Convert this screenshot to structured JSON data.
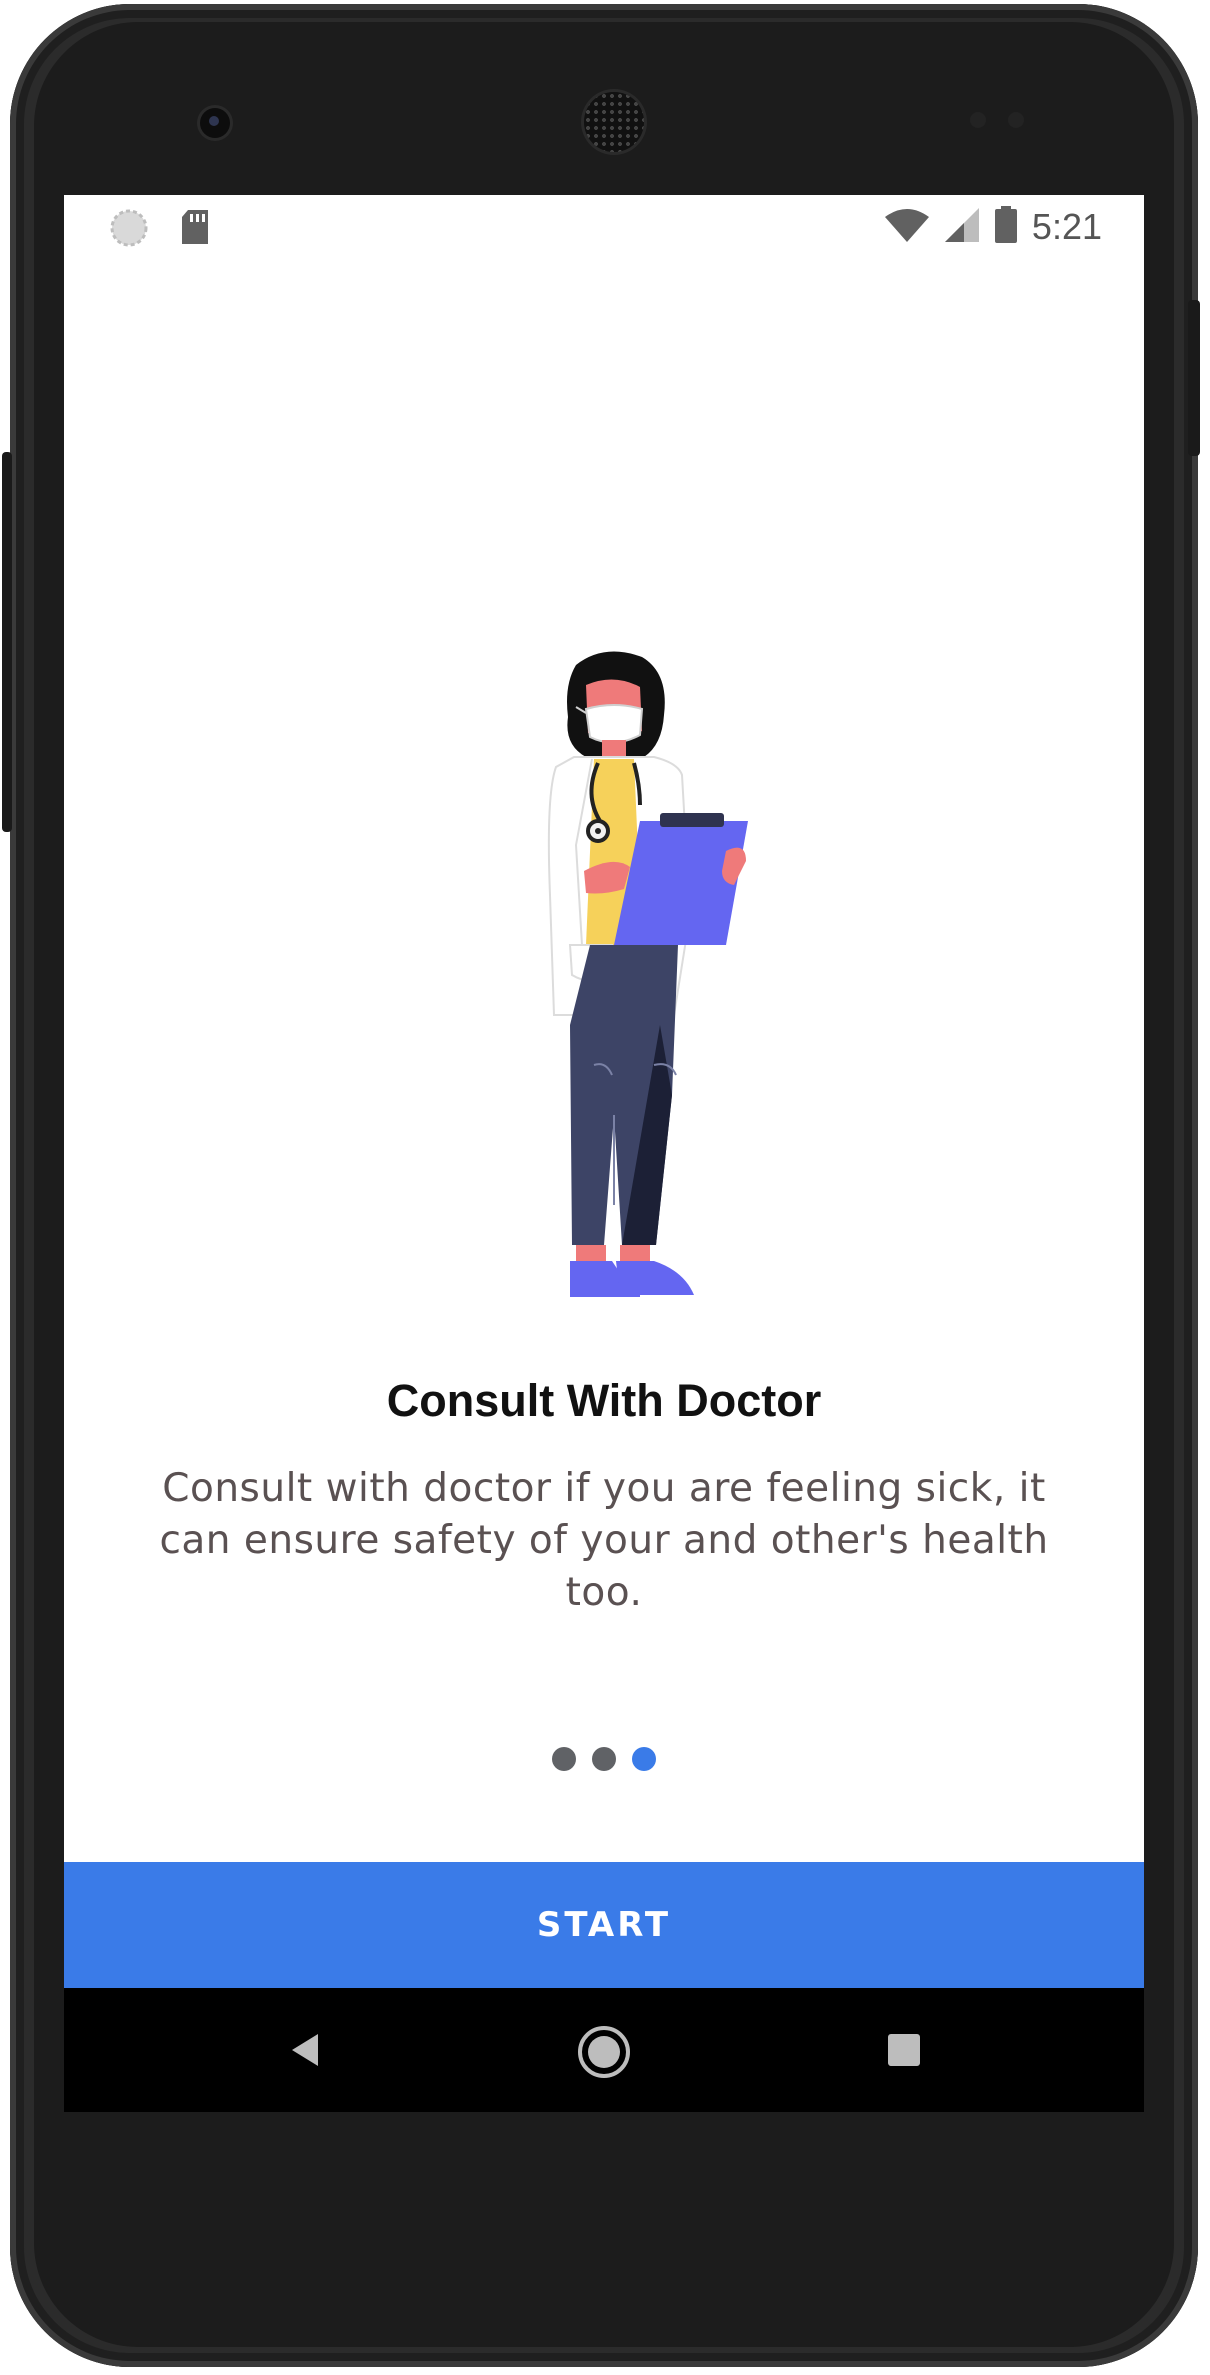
{
  "status_bar": {
    "time": "5:21",
    "icons": [
      "sync-icon",
      "sd-card-icon",
      "wifi-icon",
      "signal-icon",
      "battery-icon"
    ]
  },
  "onboarding": {
    "title": "Consult With Doctor",
    "description": "Consult with doctor if you are feeling sick, it can ensure safety of your and other's health too.",
    "page_count": 3,
    "active_page": 3
  },
  "actions": {
    "start_label": "START"
  },
  "nav_bar": {
    "icons": [
      "back-icon",
      "home-icon",
      "recents-icon"
    ]
  },
  "colors": {
    "accent": "#3a7be8",
    "dot_inactive": "#606266",
    "text_dark": "#111111",
    "text_body": "#5a5152"
  }
}
